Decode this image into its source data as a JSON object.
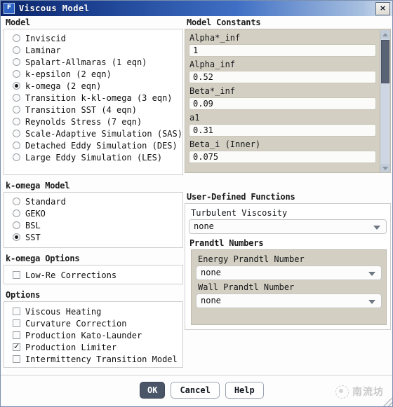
{
  "window": {
    "title": "Viscous Model",
    "app_icon": "F",
    "close_label": "×"
  },
  "model_group": {
    "title": "Model",
    "options": [
      {
        "label": "Inviscid",
        "selected": false
      },
      {
        "label": "Laminar",
        "selected": false
      },
      {
        "label": "Spalart-Allmaras (1 eqn)",
        "selected": false
      },
      {
        "label": "k-epsilon (2 eqn)",
        "selected": false
      },
      {
        "label": "k-omega (2 eqn)",
        "selected": true
      },
      {
        "label": "Transition k-kl-omega (3 eqn)",
        "selected": false
      },
      {
        "label": "Transition SST (4 eqn)",
        "selected": false
      },
      {
        "label": "Reynolds Stress (7 eqn)",
        "selected": false
      },
      {
        "label": "Scale-Adaptive Simulation (SAS)",
        "selected": false
      },
      {
        "label": "Detached Eddy Simulation (DES)",
        "selected": false
      },
      {
        "label": "Large Eddy Simulation (LES)",
        "selected": false
      }
    ]
  },
  "komega_model_group": {
    "title": "k-omega Model",
    "options": [
      {
        "label": "Standard",
        "selected": false
      },
      {
        "label": "GEKO",
        "selected": false
      },
      {
        "label": "BSL",
        "selected": false
      },
      {
        "label": "SST",
        "selected": true
      }
    ]
  },
  "komega_options_group": {
    "title": "k-omega Options",
    "options": [
      {
        "label": "Low-Re Corrections",
        "checked": false
      }
    ]
  },
  "options_group": {
    "title": "Options",
    "options": [
      {
        "label": "Viscous Heating",
        "checked": false
      },
      {
        "label": "Curvature Correction",
        "checked": false
      },
      {
        "label": "Production Kato-Launder",
        "checked": false
      },
      {
        "label": "Production Limiter",
        "checked": true
      },
      {
        "label": "Intermittency Transition Model",
        "checked": false
      }
    ]
  },
  "model_constants": {
    "title": "Model Constants",
    "fields": [
      {
        "label": "Alpha*_inf",
        "value": "1"
      },
      {
        "label": "Alpha_inf",
        "value": "0.52"
      },
      {
        "label": "Beta*_inf",
        "value": "0.09"
      },
      {
        "label": "a1",
        "value": "0.31"
      },
      {
        "label": "Beta_i (Inner)",
        "value": "0.075"
      }
    ]
  },
  "udf": {
    "title": "User-Defined Functions",
    "turbulent_viscosity_label": "Turbulent Viscosity",
    "turbulent_viscosity_value": "none",
    "prandtl": {
      "title": "Prandtl Numbers",
      "energy_label": "Energy Prandtl Number",
      "energy_value": "none",
      "wall_label": "Wall Prandtl Number",
      "wall_value": "none"
    }
  },
  "footer": {
    "ok_label": "OK",
    "cancel_label": "Cancel",
    "help_label": "Help",
    "watermark_text": "南流坊"
  }
}
